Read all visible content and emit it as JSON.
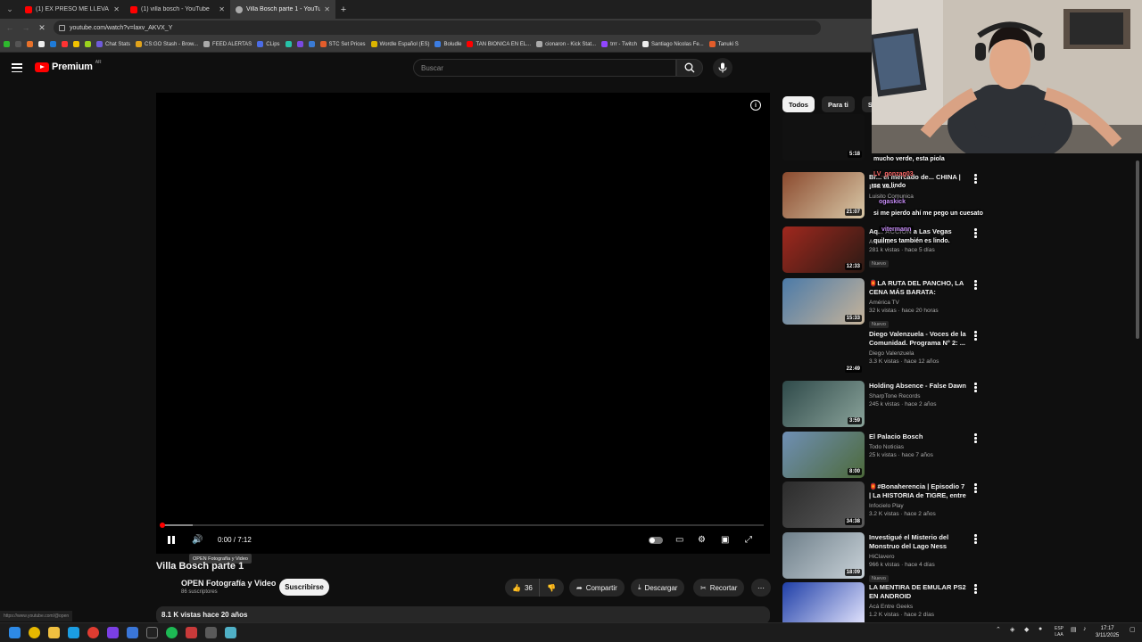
{
  "browser": {
    "tabs": [
      {
        "label": "(1) EX PRESO ME LLEVA a LOS",
        "active": false
      },
      {
        "label": "(1) villa bosch - YouTube",
        "active": false
      },
      {
        "label": "Villa Bosch parte 1 - YouTube",
        "active": true
      }
    ],
    "new_tab": "+",
    "url": "youtube.com/watch?v=laxv_AKVX_Y",
    "bookmarks": [
      {
        "label": "",
        "color": "#2eb82e"
      },
      {
        "label": "",
        "color": "#555"
      },
      {
        "label": "",
        "color": "#e8712a"
      },
      {
        "label": "",
        "color": "#eee"
      },
      {
        "label": "",
        "color": "#1f7bd8"
      },
      {
        "label": "",
        "color": "#ff3333"
      },
      {
        "label": "",
        "color": "#f2c200"
      },
      {
        "label": "",
        "color": "#9ad21e"
      },
      {
        "label": "Chat Stats",
        "color": "#6e5bd9"
      },
      {
        "label": "CS:GO Stash - Brow...",
        "color": "#e0a21b"
      },
      {
        "label": "FEED ALERTAS",
        "color": "#aaa"
      },
      {
        "label": "CLips",
        "color": "#4b6ce6"
      },
      {
        "label": "",
        "color": "#27c2a8"
      },
      {
        "label": "",
        "color": "#7a4ae0"
      },
      {
        "label": "",
        "color": "#3a7bd5"
      },
      {
        "label": "STC Set Prices",
        "color": "#e35d2b"
      },
      {
        "label": "Wordle Español (ES)",
        "color": "#dbb400"
      },
      {
        "label": "Boludle",
        "color": "#3c7de2"
      },
      {
        "label": "TAN BIONICA EN EL...",
        "color": "#ff0000"
      },
      {
        "label": "cionaron - Kick Stat...",
        "color": "#aaa"
      },
      {
        "label": "trrr - Twitch",
        "color": "#9146ff"
      },
      {
        "label": "Santiago Nicolas Fe...",
        "color": "#eee"
      },
      {
        "label": "Tanuki S",
        "color": "#e35d2b"
      }
    ]
  },
  "header": {
    "logo_text": "Premium",
    "country": "AR",
    "search_placeholder": "Buscar"
  },
  "player": {
    "time": "0:00 / 7:12",
    "progress_fraction": 0.0,
    "buffered_fraction": 0.05,
    "tooltip": "OPEN Fotografía y Video"
  },
  "video": {
    "title": "Villa Bosch parte 1",
    "channel": "OPEN Fotografía y Video",
    "subscribers": "86 suscriptores",
    "subscribe_label": "Suscribirse",
    "likes": "36",
    "share_label": "Compartir",
    "download_label": "Descargar",
    "clip_label": "Recortar",
    "views_date": "8.1 K vistas  hace 20 años",
    "status_url": "https://www.youtube.com/@open"
  },
  "sidebar": {
    "chips": [
      {
        "label": "Todos",
        "selected": true
      },
      {
        "label": "Para ti",
        "selected": false
      },
      {
        "label": "Subi",
        "selected": false
      }
    ],
    "recommendations": [
      {
        "title": "",
        "channel": "",
        "meta": "",
        "duration": "5:18",
        "is_new": false,
        "thumb": [
          "#111",
          "#111"
        ]
      },
      {
        "title": "Br... el mercado de... CHINA | ¡Ma sa...",
        "channel": "Luisito Comunica",
        "meta": "",
        "duration": "21:07",
        "is_new": false,
        "thumb": [
          "#8b4a2e",
          "#d9c9a8"
        ]
      },
      {
        "title": "Aq... ACCIÓN a Las Vegas",
        "channel": "Asesina",
        "meta": "281 k vistas · hace 5 días",
        "duration": "12:33",
        "is_new": true,
        "thumb": [
          "#a0281e",
          "#2a1a14"
        ]
      },
      {
        "title": "🏮LA RUTA DEL PANCHO, LA CENA MÁS BARATA: INFORM...",
        "channel": "América TV",
        "meta": "32 k vistas · hace 20 horas",
        "duration": "15:33",
        "is_new": true,
        "thumb": [
          "#4b7aa8",
          "#c7b49a"
        ]
      },
      {
        "title": "Diego Valenzuela - Voces de la Comunidad. Programa N° 2: ...",
        "channel": "Diego Valenzuela",
        "meta": "3.3 K vistas · hace 12 años",
        "duration": "22:49",
        "is_new": false,
        "thumb": [
          "#0f0f0f",
          "#0f0f0f"
        ]
      },
      {
        "title": "Holding Absence - False Dawn",
        "channel": "SharpTone Records",
        "meta": "245 k vistas · hace 2 años",
        "duration": "3:59",
        "is_new": false,
        "thumb": [
          "#2f4a4a",
          "#8aa39a"
        ]
      },
      {
        "title": "El Palacio Bosch",
        "channel": "Todo Noticias",
        "meta": "25 k vistas · hace 7 años",
        "duration": "8:00",
        "is_new": false,
        "thumb": [
          "#6f8fb5",
          "#4d6a3a"
        ]
      },
      {
        "title": "🏮#Bonaherencia | Episodio 7 | La HISTORIA de TIGRE, entre ...",
        "channel": "Infocielo Play",
        "meta": "3.2 K vistas · hace 2 años",
        "duration": "34:38",
        "is_new": false,
        "thumb": [
          "#2c2c2c",
          "#5a5a5a"
        ]
      },
      {
        "title": "Investigué el Misterio del Monstruo del Lago Ness",
        "channel": "HiClavero",
        "meta": "966 k vistas · hace 4 días",
        "duration": "18:09",
        "is_new": true,
        "thumb": [
          "#6e7f8a",
          "#c9d2d8"
        ]
      },
      {
        "title": "LA MENTIRA DE EMULAR PS2 EN ANDROID",
        "channel": "Acá Entre Geeks",
        "meta": "1.2 K vistas · hace 2 días",
        "duration": "",
        "is_new": false,
        "thumb": [
          "#1f3fa8",
          "#e8e8ff"
        ]
      }
    ]
  },
  "chat": [
    {
      "user": "",
      "text": "mucho verde, esta piola"
    },
    {
      "user": "LV_gonzag03",
      "text": "se ve lindo"
    },
    {
      "user": "ogaskick",
      "text": ""
    },
    {
      "user": "",
      "text": "si me pierdo ahí me pego un cuesato"
    },
    {
      "user": "vitermann",
      "text": "quilmes también es lindo."
    }
  ],
  "taskbar": {
    "lang_line1": "ESP",
    "lang_line2": "LAA",
    "clock_time": "17:17",
    "clock_date": "3/11/2025"
  }
}
